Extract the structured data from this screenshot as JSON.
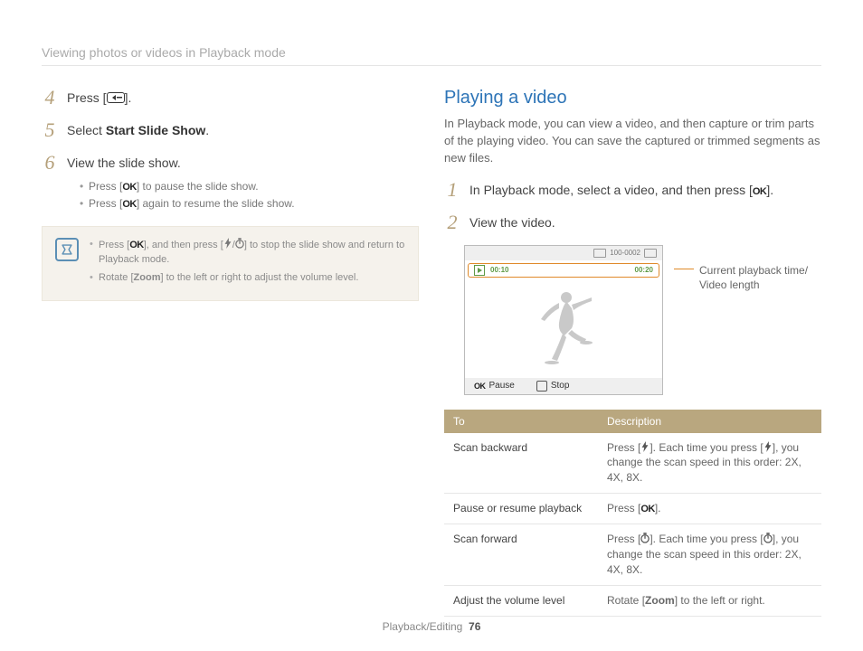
{
  "breadcrumb": "Viewing photos or videos in Playback mode",
  "left": {
    "steps": [
      {
        "n": "4",
        "html": "Press [<span class='icon-return' data-name='return-icon' data-interactable='false'></span>]."
      },
      {
        "n": "5",
        "html": "Select <b>Start Slide Show</b>."
      },
      {
        "n": "6",
        "html": "View the slide show.",
        "subs": [
          "Press [<span class='ok-glyph'>OK</span>] to pause the slide show.",
          "Press [<span class='ok-glyph'>OK</span>] again to resume the slide show."
        ]
      }
    ],
    "notes": [
      "Press [<span class='ok-glyph'>OK</span>], and then press [<span class='glyph-flash'><svg viewBox='0 0 10 14'><polygon points='6,0 1,8 4,8 3,14 9,5 6,5' fill='#777'/></svg></span>/<span class='glyph-timer'><svg viewBox='0 0 12 14'><circle cx='6' cy='8' r='5' fill='none' stroke='#777' stroke-width='1.5'/><line x1='6' y1='8' x2='6' y2='4' stroke='#777' stroke-width='1.5'/><rect x='4' y='0' width='4' height='2' fill='#777'/></svg></span>] to stop the slide show and return to Playback mode.",
      "Rotate [<b>Zoom</b>] to the left or right to adjust the volume level."
    ]
  },
  "right": {
    "heading": "Playing a video",
    "intro": "In Playback mode, you can view a video, and then capture or trim parts of the playing video. You can save the captured or trimmed segments as new files.",
    "steps": [
      {
        "n": "1",
        "html": "In Playback mode, select a video, and then press [<span class='ok-glyph'>OK</span>]."
      },
      {
        "n": "2",
        "html": "View the video."
      }
    ],
    "preview": {
      "top_label": "100-0002",
      "time_current": "00:10",
      "time_total": "00:20",
      "bottom_pause": "Pause",
      "bottom_stop": "Stop"
    },
    "callout": "Current playback time/\nVideo length",
    "table": {
      "headers": [
        "To",
        "Description"
      ],
      "rows": [
        {
          "to": "Scan backward",
          "desc": "Press [<span class='glyph-flash'><svg viewBox='0 0 10 14'><polygon points='6,0 1,8 4,8 3,14 9,5 6,5' fill='#555'/></svg></span>]. Each time you press [<span class='glyph-flash'><svg viewBox='0 0 10 14'><polygon points='6,0 1,8 4,8 3,14 9,5 6,5' fill='#555'/></svg></span>], you change the scan speed in this order: 2X, 4X, 8X."
        },
        {
          "to": "Pause or resume playback",
          "desc": "Press [<span class='ok-glyph'>OK</span>]."
        },
        {
          "to": "Scan forward",
          "desc": "Press [<span class='glyph-timer'><svg viewBox='0 0 12 14'><circle cx='6' cy='8' r='5' fill='none' stroke='#555' stroke-width='1.5'/><line x1='6' y1='8' x2='6' y2='4' stroke='#555' stroke-width='1.5'/><rect x='4' y='0' width='4' height='2' fill='#555'/></svg></span>]. Each time you press [<span class='glyph-timer'><svg viewBox='0 0 12 14'><circle cx='6' cy='8' r='5' fill='none' stroke='#555' stroke-width='1.5'/><line x1='6' y1='8' x2='6' y2='4' stroke='#555' stroke-width='1.5'/><rect x='4' y='0' width='4' height='2' fill='#555'/></svg></span>], you change the scan speed in this order: 2X, 4X, 8X."
        },
        {
          "to": "Adjust the volume level",
          "desc": "Rotate [<b>Zoom</b>] to the left or right."
        }
      ]
    }
  },
  "footer": {
    "section": "Playback/Editing",
    "page": "76"
  }
}
